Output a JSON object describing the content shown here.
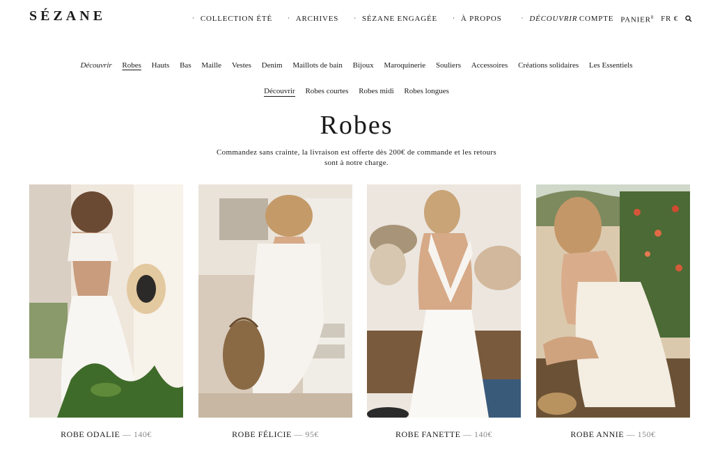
{
  "header": {
    "logo": "SÉZANE",
    "nav": [
      "COLLECTION ÉTÉ",
      "ARCHIVES",
      "SÉZANE ENGAGÉE",
      "À PROPOS",
      "DÉCOUVRIR"
    ],
    "account": "COMPTE",
    "cart": "PANIER",
    "cart_count": "0",
    "locale": "FR €"
  },
  "categories": [
    "Découvrir",
    "Robes",
    "Hauts",
    "Bas",
    "Maille",
    "Vestes",
    "Denim",
    "Maillots de bain",
    "Bijoux",
    "Maroquinerie",
    "Souliers",
    "Accessoires",
    "Créations solidaires",
    "Les Essentiels"
  ],
  "subcategories": [
    "Découvrir",
    "Robes courtes",
    "Robes midi",
    "Robes longues"
  ],
  "page": {
    "title": "Robes",
    "subtitle_line1": "Commandez sans crainte, la livraison est offerte dès 200€ de commande et les retours",
    "subtitle_line2": "sont à notre charge."
  },
  "products": [
    {
      "name": "ROBE ODALIE",
      "price": "— 140€"
    },
    {
      "name": "ROBE FÉLICIE",
      "price": "— 95€"
    },
    {
      "name": "ROBE FANETTE",
      "price": "— 140€"
    },
    {
      "name": "ROBE ANNIE",
      "price": "— 150€"
    }
  ],
  "colors": {
    "text": "#1a1a1a",
    "price": "#8a8a8a",
    "background": "#ffffff"
  }
}
